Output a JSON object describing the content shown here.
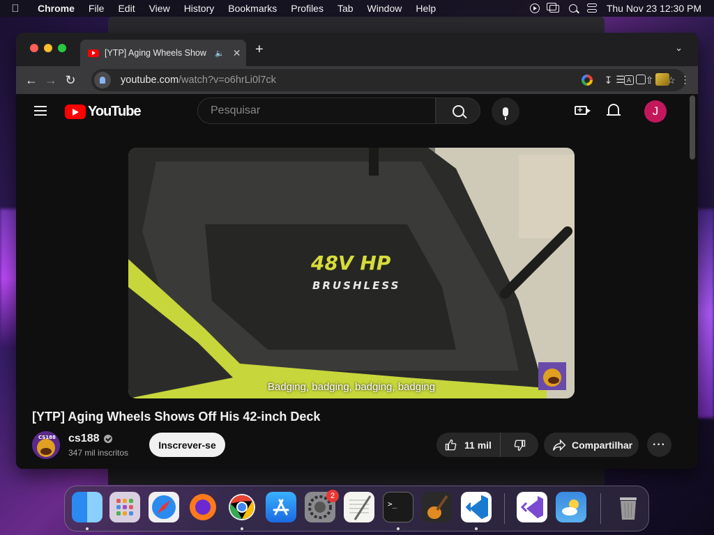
{
  "menubar": {
    "app_name": "Chrome",
    "items": [
      "File",
      "Edit",
      "View",
      "History",
      "Bookmarks",
      "Profiles",
      "Tab",
      "Window",
      "Help"
    ],
    "clock": "Thu Nov 23  12:30 PM"
  },
  "browser": {
    "tab": {
      "title": "[YTP] Aging Wheels Show",
      "audio_icon": "speaker-icon"
    },
    "new_tab_label": "+",
    "url_host": "youtube.com",
    "url_path": "/watch?v=o6hrLi0l7ck"
  },
  "youtube": {
    "logo_text": "YouTube",
    "search_placeholder": "Pesquisar",
    "avatar_letter": "J",
    "video_caption": "Badging, badging, badging, badging",
    "video_badge_line1": "48V HP",
    "video_badge_line2": "BRUSHLESS",
    "video_title": "[YTP] Aging Wheels Shows Off His 42-inch Deck",
    "channel_name": "cs188",
    "channel_avatar_text": "CS188",
    "subscribers": "347 mil inscritos",
    "subscribe_label": "Inscrever-se",
    "likes": "11 mil",
    "share_label": "Compartilhar",
    "more_label": "···"
  },
  "dock": {
    "apps": [
      "Finder",
      "Launchpad",
      "Safari",
      "Firefox",
      "Chrome",
      "App Store",
      "System Settings",
      "TextEdit",
      "Terminal",
      "GarageBand",
      "VS Code",
      "Visual Studio",
      "Weather",
      "Trash"
    ],
    "settings_badge": "2"
  },
  "colors": {
    "youtube_red": "#ff0000",
    "avatar_bg": "#c2185b",
    "page_bg": "#0f0f0f"
  }
}
